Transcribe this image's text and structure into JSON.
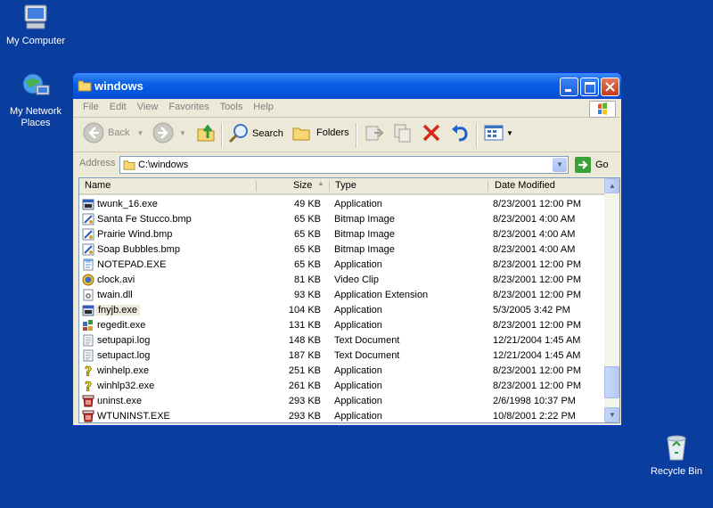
{
  "desktop": {
    "icons": [
      {
        "label": "My Computer"
      },
      {
        "label": "My Network Places"
      },
      {
        "label": "Recycle Bin"
      }
    ]
  },
  "window": {
    "title": "windows",
    "menu": [
      "File",
      "Edit",
      "View",
      "Favorites",
      "Tools",
      "Help"
    ],
    "toolbar": {
      "back": "Back",
      "search": "Search",
      "folders": "Folders"
    },
    "address": {
      "label": "Address",
      "value": "C:\\windows",
      "go": "Go"
    },
    "columns": {
      "name": "Name",
      "size": "Size",
      "type": "Type",
      "date": "Date Modified"
    },
    "files": [
      {
        "name": "twunk_16.exe",
        "size": "49 KB",
        "type": "Application",
        "date": "8/23/2001 12:00 PM",
        "icon": "exe-icon"
      },
      {
        "name": "Santa Fe Stucco.bmp",
        "size": "65 KB",
        "type": "Bitmap Image",
        "date": "8/23/2001 4:00 AM",
        "icon": "bitmap-icon"
      },
      {
        "name": "Prairie Wind.bmp",
        "size": "65 KB",
        "type": "Bitmap Image",
        "date": "8/23/2001 4:00 AM",
        "icon": "bitmap-icon"
      },
      {
        "name": "Soap Bubbles.bmp",
        "size": "65 KB",
        "type": "Bitmap Image",
        "date": "8/23/2001 4:00 AM",
        "icon": "bitmap-icon"
      },
      {
        "name": "NOTEPAD.EXE",
        "size": "65 KB",
        "type": "Application",
        "date": "8/23/2001 12:00 PM",
        "icon": "notepad-icon"
      },
      {
        "name": "clock.avi",
        "size": "81 KB",
        "type": "Video Clip",
        "date": "8/23/2001 12:00 PM",
        "icon": "video-icon"
      },
      {
        "name": "twain.dll",
        "size": "93 KB",
        "type": "Application Extension",
        "date": "8/23/2001 12:00 PM",
        "icon": "dll-icon"
      },
      {
        "name": "fnyjb.exe",
        "size": "104 KB",
        "type": "Application",
        "date": "5/3/2005 3:42 PM",
        "icon": "exe-icon"
      },
      {
        "name": "regedit.exe",
        "size": "131 KB",
        "type": "Application",
        "date": "8/23/2001 12:00 PM",
        "icon": "regedit-icon"
      },
      {
        "name": "setupapi.log",
        "size": "148 KB",
        "type": "Text Document",
        "date": "12/21/2004 1:45 AM",
        "icon": "text-icon"
      },
      {
        "name": "setupact.log",
        "size": "187 KB",
        "type": "Text Document",
        "date": "12/21/2004 1:45 AM",
        "icon": "text-icon"
      },
      {
        "name": "winhelp.exe",
        "size": "251 KB",
        "type": "Application",
        "date": "8/23/2001 12:00 PM",
        "icon": "help-icon"
      },
      {
        "name": "winhlp32.exe",
        "size": "261 KB",
        "type": "Application",
        "date": "8/23/2001 12:00 PM",
        "icon": "help-icon"
      },
      {
        "name": "uninst.exe",
        "size": "293 KB",
        "type": "Application",
        "date": "2/6/1998 10:37 PM",
        "icon": "uninstall-icon"
      },
      {
        "name": "WTUNINST.EXE",
        "size": "293 KB",
        "type": "Application",
        "date": "10/8/2001 2:22 PM",
        "icon": "uninstall-icon"
      }
    ]
  }
}
